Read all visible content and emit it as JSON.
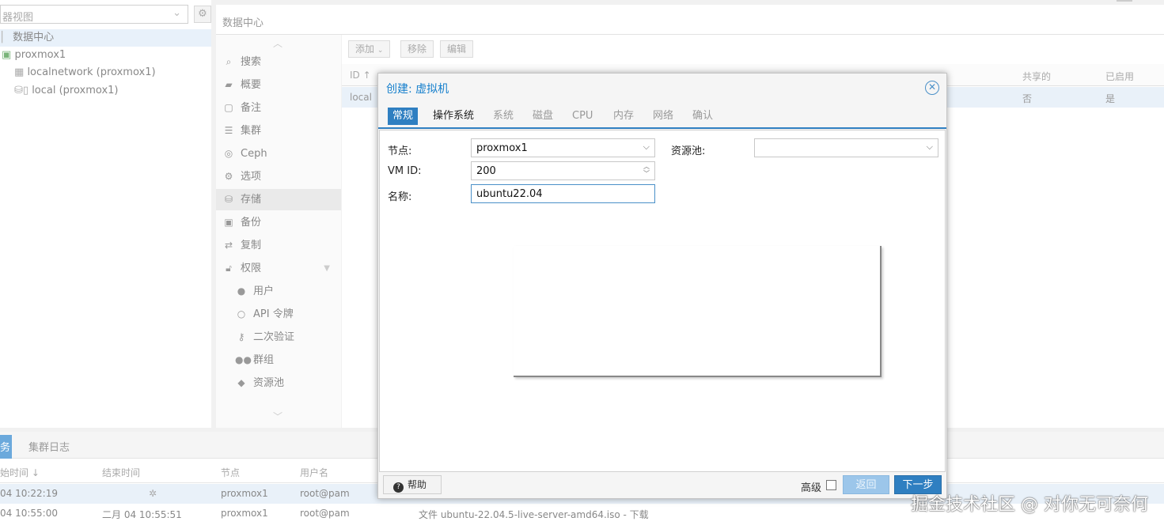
{
  "tree": {
    "view_selector": "器视图",
    "datacenter": "数据中心",
    "node": "proxmox1",
    "storage1": "localnetwork (proxmox1)",
    "storage2": "local (proxmox1)"
  },
  "main": {
    "title": "数据中心",
    "nav": [
      {
        "icon": "search-icon",
        "label": "搜索"
      },
      {
        "icon": "book-icon",
        "label": "概要"
      },
      {
        "icon": "note-icon",
        "label": "备注"
      },
      {
        "icon": "server-icon",
        "label": "集群"
      },
      {
        "icon": "ceph-icon",
        "label": "Ceph"
      },
      {
        "icon": "gear-icon",
        "label": "选项"
      },
      {
        "icon": "database-icon",
        "label": "存储"
      },
      {
        "icon": "floppy-icon",
        "label": "备份"
      },
      {
        "icon": "retweet-icon",
        "label": "复制"
      },
      {
        "icon": "unlock-icon",
        "label": "权限"
      },
      {
        "icon": "user-icon",
        "label": "用户"
      },
      {
        "icon": "user-outline-icon",
        "label": "API 令牌"
      },
      {
        "icon": "key-icon",
        "label": "二次验证"
      },
      {
        "icon": "users-icon",
        "label": "群组"
      },
      {
        "icon": "tags-icon",
        "label": "资源池"
      }
    ],
    "toolbar": {
      "add": "添加",
      "remove": "移除",
      "edit": "编辑"
    },
    "grid": {
      "headers": [
        "ID ↑",
        "共享的",
        "已启用"
      ],
      "row": {
        "id": "local",
        "shared": "否",
        "enabled": "是"
      }
    }
  },
  "bottom": {
    "tabs": [
      "务",
      "集群日志"
    ],
    "headers": [
      "始时间 ↓",
      "结束时间",
      "节点",
      "用户名"
    ],
    "rows": [
      {
        "start": "04 10:22:19",
        "end": "",
        "node": "proxmox1",
        "user": "root@pam",
        "desc": ""
      },
      {
        "start": "04 10:55:00",
        "end": "二月 04 10:55:51",
        "node": "proxmox1",
        "user": "root@pam",
        "desc": "文件 ubuntu-22.04.5-live-server-amd64.iso - 下载"
      }
    ]
  },
  "dialog": {
    "title": "创建: 虚拟机",
    "tabs": [
      {
        "label": "常规",
        "state": "active"
      },
      {
        "label": "操作系统",
        "state": "enabled"
      },
      {
        "label": "系统",
        "state": "disabled"
      },
      {
        "label": "磁盘",
        "state": "disabled"
      },
      {
        "label": "CPU",
        "state": "disabled"
      },
      {
        "label": "内存",
        "state": "disabled"
      },
      {
        "label": "网络",
        "state": "disabled"
      },
      {
        "label": "确认",
        "state": "disabled"
      }
    ],
    "form": {
      "node_label": "节点:",
      "node_value": "proxmox1",
      "vmid_label": "VM ID:",
      "vmid_value": "200",
      "name_label": "名称:",
      "name_value": "ubuntu22.04",
      "pool_label": "资源池:",
      "pool_value": ""
    },
    "footer": {
      "help": "帮助",
      "advanced": "高级",
      "advanced_checked": false,
      "back": "返回",
      "next": "下一步"
    }
  },
  "watermark": "掘金技术社区 @ 对你无可奈何",
  "colors": {
    "accent": "#2f7fc1",
    "title": "#157fcc",
    "selected_row": "#e9f1f9"
  }
}
